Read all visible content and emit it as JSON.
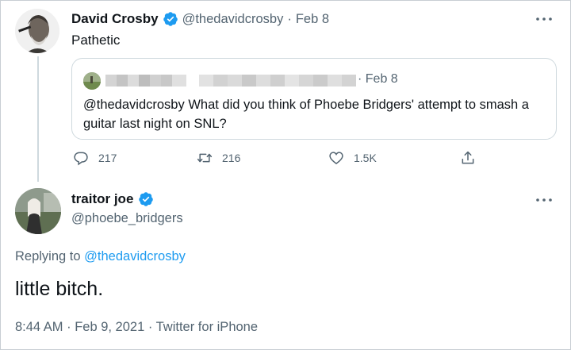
{
  "tweet1": {
    "display_name": "David Crosby",
    "handle": "@thedavidcrosby",
    "separator": "·",
    "date": "Feb 8",
    "text": "Pathetic",
    "verified": true,
    "more_icon": "more-horizontal-icon"
  },
  "quoted": {
    "separator": "·",
    "date": "Feb 8",
    "text": "@thedavidcrosby What did you think of Phoebe Bridgers' attempt to smash a guitar last night on SNL?"
  },
  "actions": {
    "reply_count": "217",
    "retweet_count": "216",
    "like_count": "1.5K"
  },
  "tweet2": {
    "display_name": "traitor joe",
    "handle": "@phoebe_bridgers",
    "replying_prefix": "Replying to",
    "replying_to": "@thedavidcrosby",
    "text": "little bitch.",
    "timestamp": "8:44 AM · Feb 9, 2021 · Twitter for iPhone",
    "verified": true
  },
  "colors": {
    "accent": "#1d9bf0",
    "secondary_text": "#536471",
    "border": "#cfd9de"
  }
}
